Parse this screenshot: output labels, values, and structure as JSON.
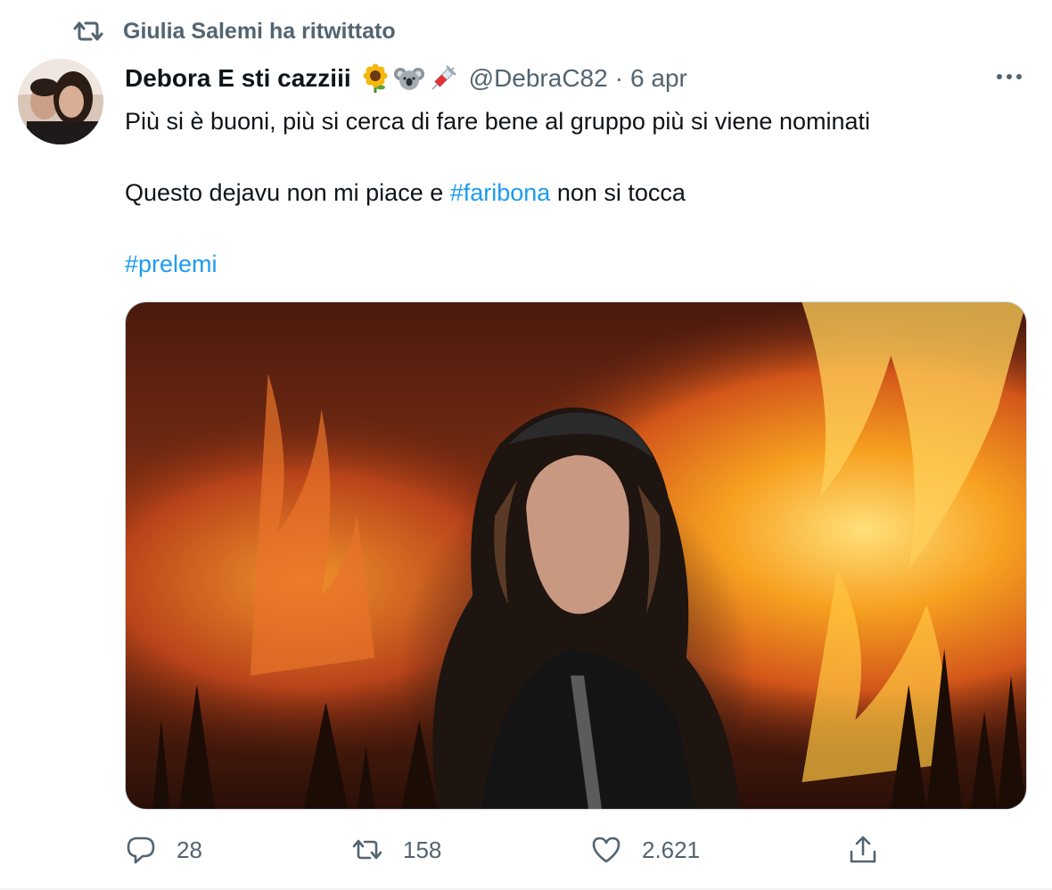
{
  "retweet_context": {
    "text": "Giulia Salemi ha ritwittato",
    "icon": "retweet-icon"
  },
  "author": {
    "display_name": "Debora E sti cazziii",
    "emojis": [
      "sunflower-icon",
      "koala-icon",
      "syringe-icon"
    ],
    "handle": "@DebraC82",
    "separator": "·",
    "date": "6 apr"
  },
  "tweet": {
    "line1": "Più si è buoni, più si cerca di fare bene al gruppo più si viene nominati",
    "line2_before": "Questo dejavu non mi piace e ",
    "line2_hashtag": "#faribona",
    "line2_after": " non si tocca",
    "line3_hashtag": "#prelemi"
  },
  "media": {
    "description_icon": "photo-woman-fire"
  },
  "actions": {
    "reply": {
      "icon": "reply-icon",
      "count": "28"
    },
    "retweet": {
      "icon": "retweet-icon",
      "count": "158"
    },
    "like": {
      "icon": "heart-icon",
      "count": "2.621"
    },
    "share": {
      "icon": "share-icon"
    }
  },
  "colors": {
    "link": "#1d9bf0",
    "secondary": "#536471",
    "text": "#0f1419"
  }
}
